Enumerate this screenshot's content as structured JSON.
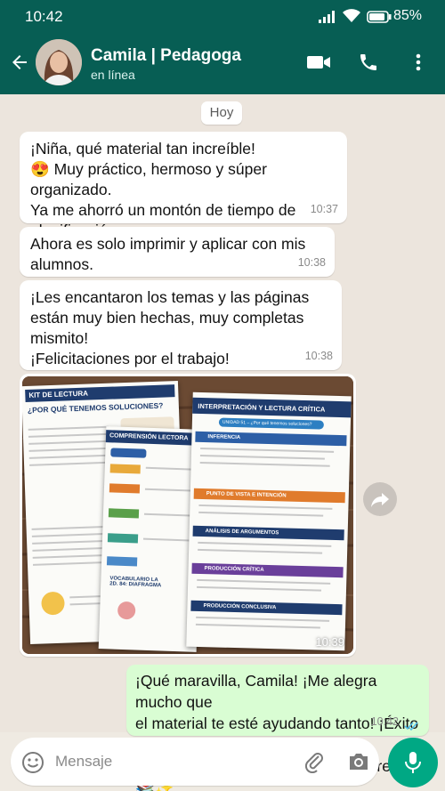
{
  "status_bar": {
    "time": "10:42",
    "battery": "85%"
  },
  "header": {
    "contact_name": "Camila | Pedagoga",
    "status": "en línea"
  },
  "day_chip": "Hoy",
  "messages": [
    {
      "text": "¡Niña, qué material tan increíble!\n😍 Muy práctico, hermoso y súper organizado.\nYa me ahorró un montón de tiempo de\nplanificación.",
      "time": "10:37"
    },
    {
      "text": "Ahora es solo imprimir y aplicar con mis\nalumnos.",
      "time": "10:38"
    },
    {
      "text": "¡Les encantaron los temas y las páginas\nestán muy bien hechas, muy completas\nmismito!\n¡Felicitaciones por el trabajo!",
      "time": "10:38"
    }
  ],
  "image_message": {
    "time": "10:39",
    "image_text": {
      "kit_title": "KIT DE LECTURA",
      "kit_subtitle": "¿POR QUÉ TENEMOS SOLUCIONES?",
      "comp_title": "COMPRENSIÓN LECTORA",
      "interp_title": "INTERPRETACIÓN Y LECTURA CRÍTICA",
      "unit_label": "UNIDAD 51 – ¿Por qué tenemos soluciones?",
      "sections": [
        "INFERENCIA",
        "PUNTO DE VISTA E INTENCIÓN",
        "ANÁLISIS DE ARGUMENTOS",
        "PRODUCCIÓN CRÍTICA",
        "PRODUCCIÓN CONCLUSIVA"
      ],
      "vocab": "VOCABULARIO LA 2D. 84: DIAFRAGMA"
    }
  },
  "outgoing": {
    "text": "¡Qué maravilla, Camila! ¡Me alegra mucho que\nel material te esté ayudando tanto! ¡Éxito en\nlas clases! ¡Cuenta conmigo siempre! 😊📚✨",
    "time": "10:42"
  },
  "input": {
    "placeholder": "Mensaje"
  },
  "colors": {
    "header": "#075e54",
    "accent": "#00a884",
    "outgoing_bubble": "#d9fdd3",
    "chat_bg": "#ece5dd"
  },
  "icons": [
    "back-arrow-icon",
    "video-call-icon",
    "phone-icon",
    "more-options-icon",
    "forward-icon",
    "emoji-icon",
    "attach-icon",
    "camera-icon",
    "mic-icon",
    "read-ticks-icon"
  ]
}
